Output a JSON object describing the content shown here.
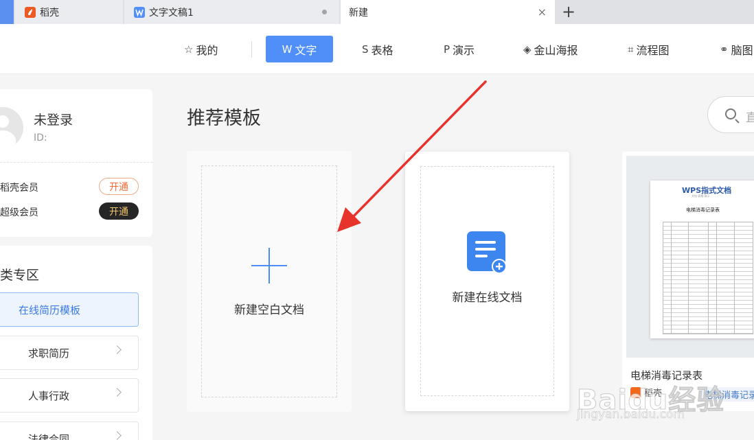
{
  "tabs": [
    {
      "label": "稻壳",
      "icon": "daoke-icon",
      "color": "#ee5a24"
    },
    {
      "label": "文字文稿1",
      "icon": "wps-writer-icon",
      "color": "#4f8ff7"
    },
    {
      "label": "新建",
      "close": "×"
    }
  ],
  "tab_add": "+",
  "nav": {
    "items": [
      {
        "label": "我的",
        "icon": "☆"
      },
      {
        "label": "文字",
        "icon": "W"
      },
      {
        "label": "表格",
        "icon": "S"
      },
      {
        "label": "演示",
        "icon": "P"
      },
      {
        "label": "金山海报",
        "icon": "◈"
      },
      {
        "label": "流程图",
        "icon": "⌗"
      },
      {
        "label": "脑图",
        "icon": "⚭"
      }
    ],
    "active_color": "#4f8ff7"
  },
  "profile": {
    "name": "未登录",
    "id_label": "ID:",
    "memberships": [
      {
        "label": "稻壳会员",
        "button": "开通"
      },
      {
        "label": "超级会员",
        "button": "开通"
      }
    ]
  },
  "zone": {
    "title": "类专区",
    "items": [
      "在线简历模板",
      "求职简历",
      "人事行政",
      "法律合同"
    ]
  },
  "main": {
    "section_title": "推荐模板",
    "search_placeholder": "直",
    "cards": {
      "blank": "新建空白文档",
      "online": "新建在线文档"
    },
    "template": {
      "logo": "WPS指式文档",
      "subtitle": "文档·表格·演示",
      "doc_title": "电梯消毒记录表",
      "title": "电梯消毒记录表",
      "author": "稻壳",
      "tag": "电梯消毒记录表"
    }
  },
  "watermark": {
    "text": "Baidu经验",
    "url": "jingyan.baidu.com"
  },
  "colors": {
    "accent": "#4f8ff7",
    "annotation_arrow": "#e8322c"
  }
}
